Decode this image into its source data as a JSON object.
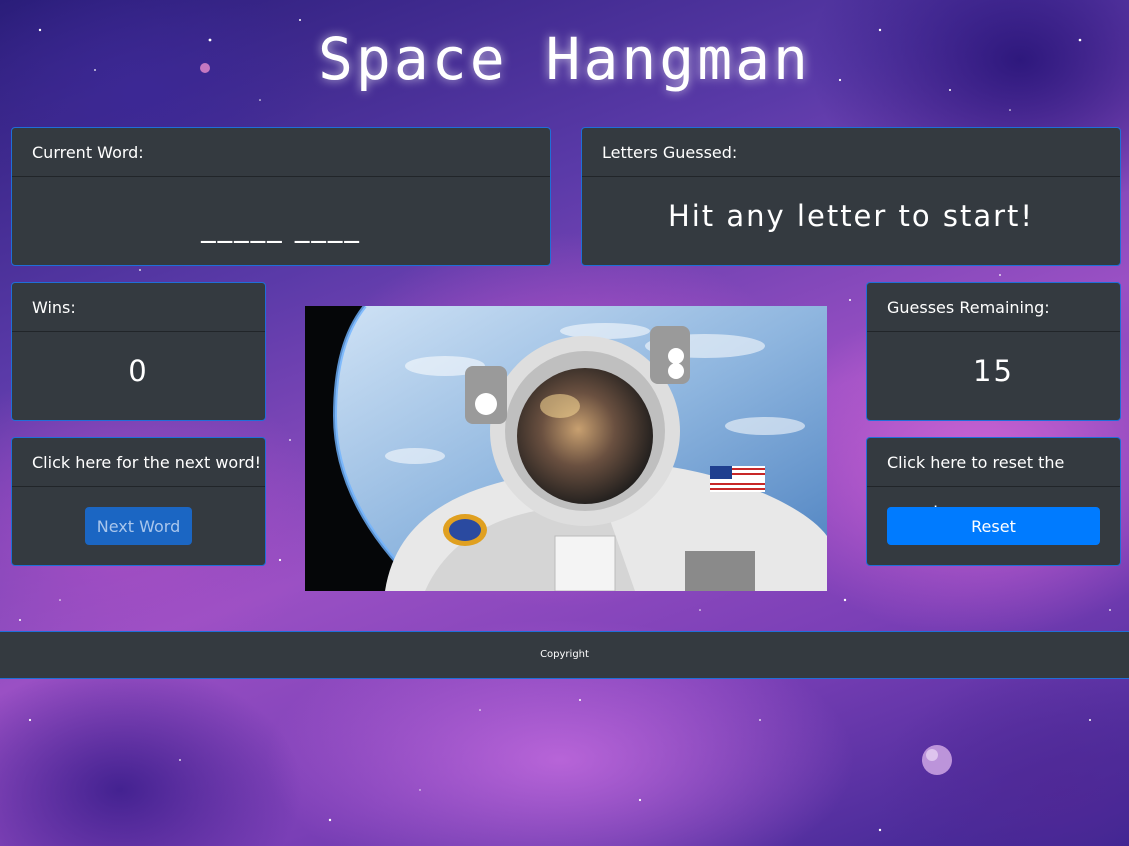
{
  "title": "Space Hangman",
  "current_word": {
    "label": "Current Word:",
    "value": "_____ ____"
  },
  "letters_guessed": {
    "label": "Letters Guessed:",
    "value": "Hit any letter to start!"
  },
  "wins": {
    "label": "Wins:",
    "value": "0"
  },
  "guesses_remaining": {
    "label": "Guesses Remaining:",
    "value": "15"
  },
  "next_word": {
    "label": "Click here for the next word!",
    "button": "Next Word"
  },
  "reset": {
    "label": "Click here to reset the game!",
    "button": "Reset"
  },
  "image": {
    "subject": "astronaut-in-orbit-photo"
  },
  "footer": {
    "text": "Copyright"
  },
  "colors": {
    "card_bg": "#343a40",
    "card_border": "#1f6fd8",
    "next_button": "#1b66c3",
    "next_button_text": "#a9c6ec",
    "reset_button": "#007bff"
  }
}
